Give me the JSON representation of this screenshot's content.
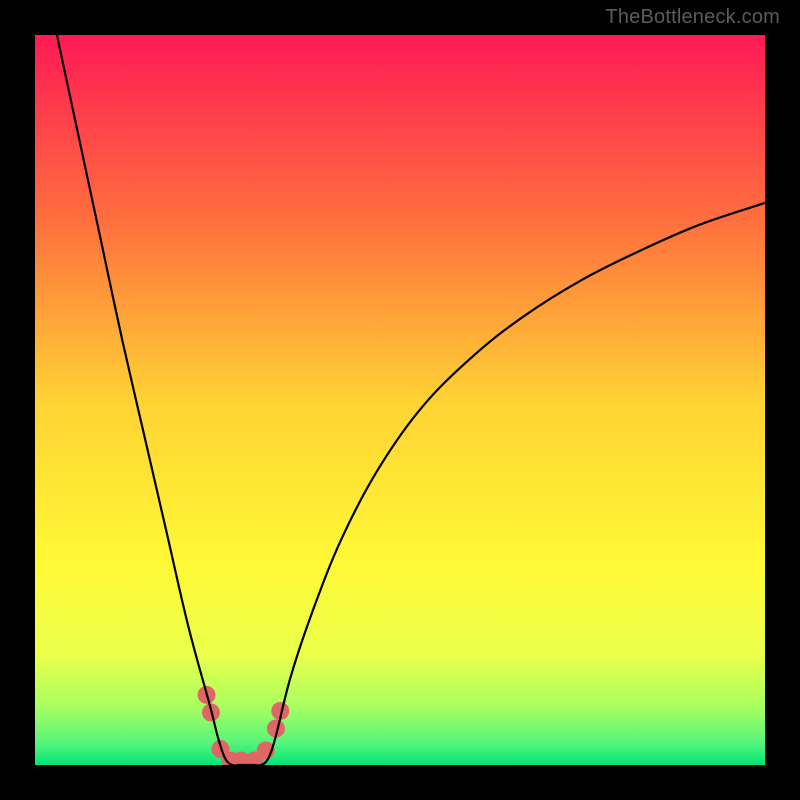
{
  "watermark": "TheBottleneck.com",
  "chart_data": {
    "type": "line",
    "title": "",
    "xlabel": "",
    "ylabel": "",
    "xlim": [
      0,
      1
    ],
    "ylim": [
      0,
      1
    ],
    "background_gradient": [
      {
        "pos": 0.0,
        "color": "#ff1a55"
      },
      {
        "pos": 0.25,
        "color": "#ff6e3e"
      },
      {
        "pos": 0.5,
        "color": "#ffd233"
      },
      {
        "pos": 0.72,
        "color": "#fff835"
      },
      {
        "pos": 0.85,
        "color": "#eaff4a"
      },
      {
        "pos": 0.92,
        "color": "#a8ff60"
      },
      {
        "pos": 0.97,
        "color": "#55f57a"
      },
      {
        "pos": 1.0,
        "color": "#00e57a"
      }
    ],
    "series": [
      {
        "name": "bottleneck-curve",
        "x": [
          0.03,
          0.06,
          0.09,
          0.12,
          0.15,
          0.18,
          0.21,
          0.24,
          0.25,
          0.26,
          0.27,
          0.28,
          0.29,
          0.3,
          0.31,
          0.32,
          0.33,
          0.35,
          0.38,
          0.42,
          0.47,
          0.53,
          0.6,
          0.67,
          0.75,
          0.83,
          0.91,
          1.0
        ],
        "values": [
          1.0,
          0.86,
          0.72,
          0.58,
          0.45,
          0.32,
          0.19,
          0.08,
          0.04,
          0.01,
          0.0,
          0.0,
          0.0,
          0.0,
          0.0,
          0.01,
          0.04,
          0.12,
          0.21,
          0.31,
          0.405,
          0.49,
          0.56,
          0.615,
          0.665,
          0.705,
          0.74,
          0.77
        ]
      }
    ],
    "markers": {
      "name": "highlight-points",
      "color": "#e06666",
      "radius": 9,
      "points": [
        {
          "x": 0.235,
          "y": 0.096
        },
        {
          "x": 0.241,
          "y": 0.072
        },
        {
          "x": 0.254,
          "y": 0.022
        },
        {
          "x": 0.268,
          "y": 0.006
        },
        {
          "x": 0.282,
          "y": 0.006
        },
        {
          "x": 0.3,
          "y": 0.006
        },
        {
          "x": 0.316,
          "y": 0.02
        },
        {
          "x": 0.33,
          "y": 0.05
        },
        {
          "x": 0.336,
          "y": 0.074
        }
      ]
    }
  }
}
